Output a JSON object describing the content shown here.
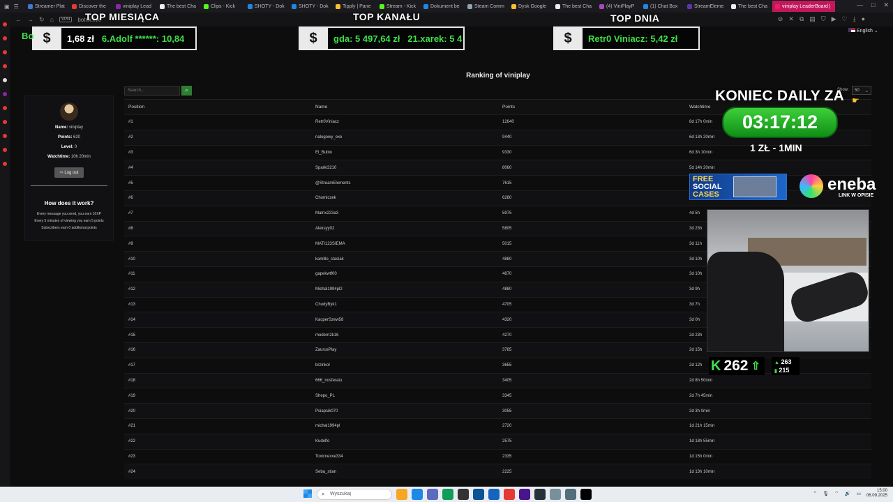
{
  "browser": {
    "tabs": [
      {
        "label": "Streamer Plat",
        "color": "#3a7bd5"
      },
      {
        "label": "Discover the",
        "color": "#e53935"
      },
      {
        "label": "viniplay Lead",
        "color": "#8e24aa"
      },
      {
        "label": "The best Cha",
        "color": "#eeeeee"
      },
      {
        "label": "Clips - Kick",
        "color": "#53fc18"
      },
      {
        "label": "SHOTY - Dok",
        "color": "#1e88e5"
      },
      {
        "label": "SHOTY - Dok",
        "color": "#1e88e5"
      },
      {
        "label": "Tipply | Pane",
        "color": "#fbc02d"
      },
      {
        "label": "Stream - Kick",
        "color": "#53fc18"
      },
      {
        "label": "Dokument be",
        "color": "#1e88e5"
      },
      {
        "label": "Steam Comm",
        "color": "#90a4ae"
      },
      {
        "label": "Dysk Google",
        "color": "#fbc02d"
      },
      {
        "label": "The best Cha",
        "color": "#eeeeee"
      },
      {
        "label": "(4) ViniPlayP",
        "color": "#ab47bc"
      },
      {
        "label": "(1) Chat Box",
        "color": "#1e88e5"
      },
      {
        "label": "StreamEleme",
        "color": "#5e35b1"
      },
      {
        "label": "The best Cha",
        "color": "#eeeeee"
      },
      {
        "label": "viniplay LeaderBoard |",
        "color": "#e91e63"
      }
    ],
    "vpn_badge": "VPN",
    "url": "botrix.live",
    "language": "English",
    "window_controls": [
      "—",
      "□",
      "✕"
    ]
  },
  "overlay": {
    "banners": [
      {
        "title": "TOP MIESIĄCA",
        "dollar": "$",
        "text_a": "1,68 zł",
        "text_b": "6.Adolf ******: 10,84",
        "left_fragment": "Bo"
      },
      {
        "title": "TOP KANAŁU",
        "dollar": "$",
        "text_a": "gda: 5 497,64 zł",
        "text_b": "21.xarek: 5 4"
      },
      {
        "title": "TOP DNIA",
        "dollar": "$",
        "text_a": "Retr0 Viniacz: 5,42 zł"
      }
    ],
    "countdown_title": "KONIEC DAILY ZA",
    "countdown_time": "03:17:12",
    "rate": "1 ZŁ - 1MIN",
    "free_cases": [
      "FREE",
      "SOCIAL",
      "CASES"
    ],
    "eneba_name": "eneba",
    "eneba_sub": "LINK W OPISIE",
    "viewer_count": "262",
    "viewer_stat_1": "263",
    "viewer_stat_2": "215"
  },
  "page": {
    "title": "Ranking of viniplay",
    "search_placeholder": "Search...",
    "show_label": "Show:",
    "show_value": "50",
    "profile": {
      "name_label": "Name:",
      "name": "viniplay",
      "points_label": "Points:",
      "points": "620",
      "level_label": "Level:",
      "level": "0",
      "watch_label": "Watchtime:",
      "watch": "10h 20min",
      "logout": "Log out"
    },
    "how": {
      "title": "How does it work?",
      "lines": [
        "Every message you send, you earn 10XP",
        "Every 5 minutes of viewing you earn 5 points",
        "Subscribers earn 0 additional points"
      ]
    },
    "columns": [
      "Position",
      "Name",
      "Points",
      "Watchtime"
    ],
    "rows": [
      [
        "#1",
        "Retr0Viniacz",
        "12640",
        "8d 17h 0min"
      ],
      [
        "#2",
        "nalogowy_exe",
        "9440",
        "6d 13h 20min"
      ],
      [
        "#3",
        "El_Bubio",
        "9330",
        "6d 3h 10min"
      ],
      [
        "#4",
        "Sparki3210",
        "8060",
        "5d 14h 20min"
      ],
      [
        "#5",
        "@StreamElements",
        "7615",
        ""
      ],
      [
        "#6",
        "Chomiczek",
        "6280",
        ""
      ],
      [
        "#7",
        "Matrix223a3",
        "5975",
        "4d 5h"
      ],
      [
        "#8",
        "Aleksyy02",
        "5805",
        "3d 23h"
      ],
      [
        "#9",
        "MATI123SIEMA",
        "5015",
        "3d 11h"
      ],
      [
        "#10",
        "kamillo_stasiak",
        "4880",
        "3d 10h"
      ],
      [
        "#11",
        "gapekwtf00",
        "4870",
        "3d 10h"
      ],
      [
        "#12",
        "Michal1994pl2",
        "4880",
        "3d 9h"
      ],
      [
        "#13",
        "ChudyByk1",
        "4705",
        "3d 7h"
      ],
      [
        "#14",
        "KacperSzew58",
        "4320",
        "3d 0h"
      ],
      [
        "#15",
        "modern2k16",
        "4270",
        "2d 23h"
      ],
      [
        "#16",
        "ZaurusPlay",
        "3785",
        "2d 15h"
      ],
      [
        "#17",
        "brzinkol",
        "3655",
        "2d 12h"
      ],
      [
        "#18",
        "666_nosferatu",
        "3405",
        "2d 8h 50min"
      ],
      [
        "#19",
        "Shepo_PL",
        "3345",
        "2d 7h 45min"
      ],
      [
        "#20",
        "Psiapsik070",
        "3055",
        "2d 3h 0min"
      ],
      [
        "#21",
        "michal1994pl",
        "2720",
        "1d 21h 15min"
      ],
      [
        "#22",
        "Kudelfo",
        "2575",
        "1d 18h 55min"
      ],
      [
        "#23",
        "Toxicnexxe334",
        "2335",
        "1d 15h 0min"
      ],
      [
        "#24",
        "Seba_stian",
        "2225",
        "1d 13h 10min"
      ]
    ]
  },
  "taskbar": {
    "search_placeholder": "Wyszukaj",
    "time": "15:00",
    "date": "06.09.2025",
    "apps": [
      "#f5a623",
      "#1e88e5",
      "#5c6bc0",
      "#0f9d58",
      "#333333",
      "#0b5394",
      "#1565c0",
      "#e53935",
      "#4a148c",
      "#263238",
      "#78909c",
      "#546e7a",
      "#000000"
    ]
  }
}
